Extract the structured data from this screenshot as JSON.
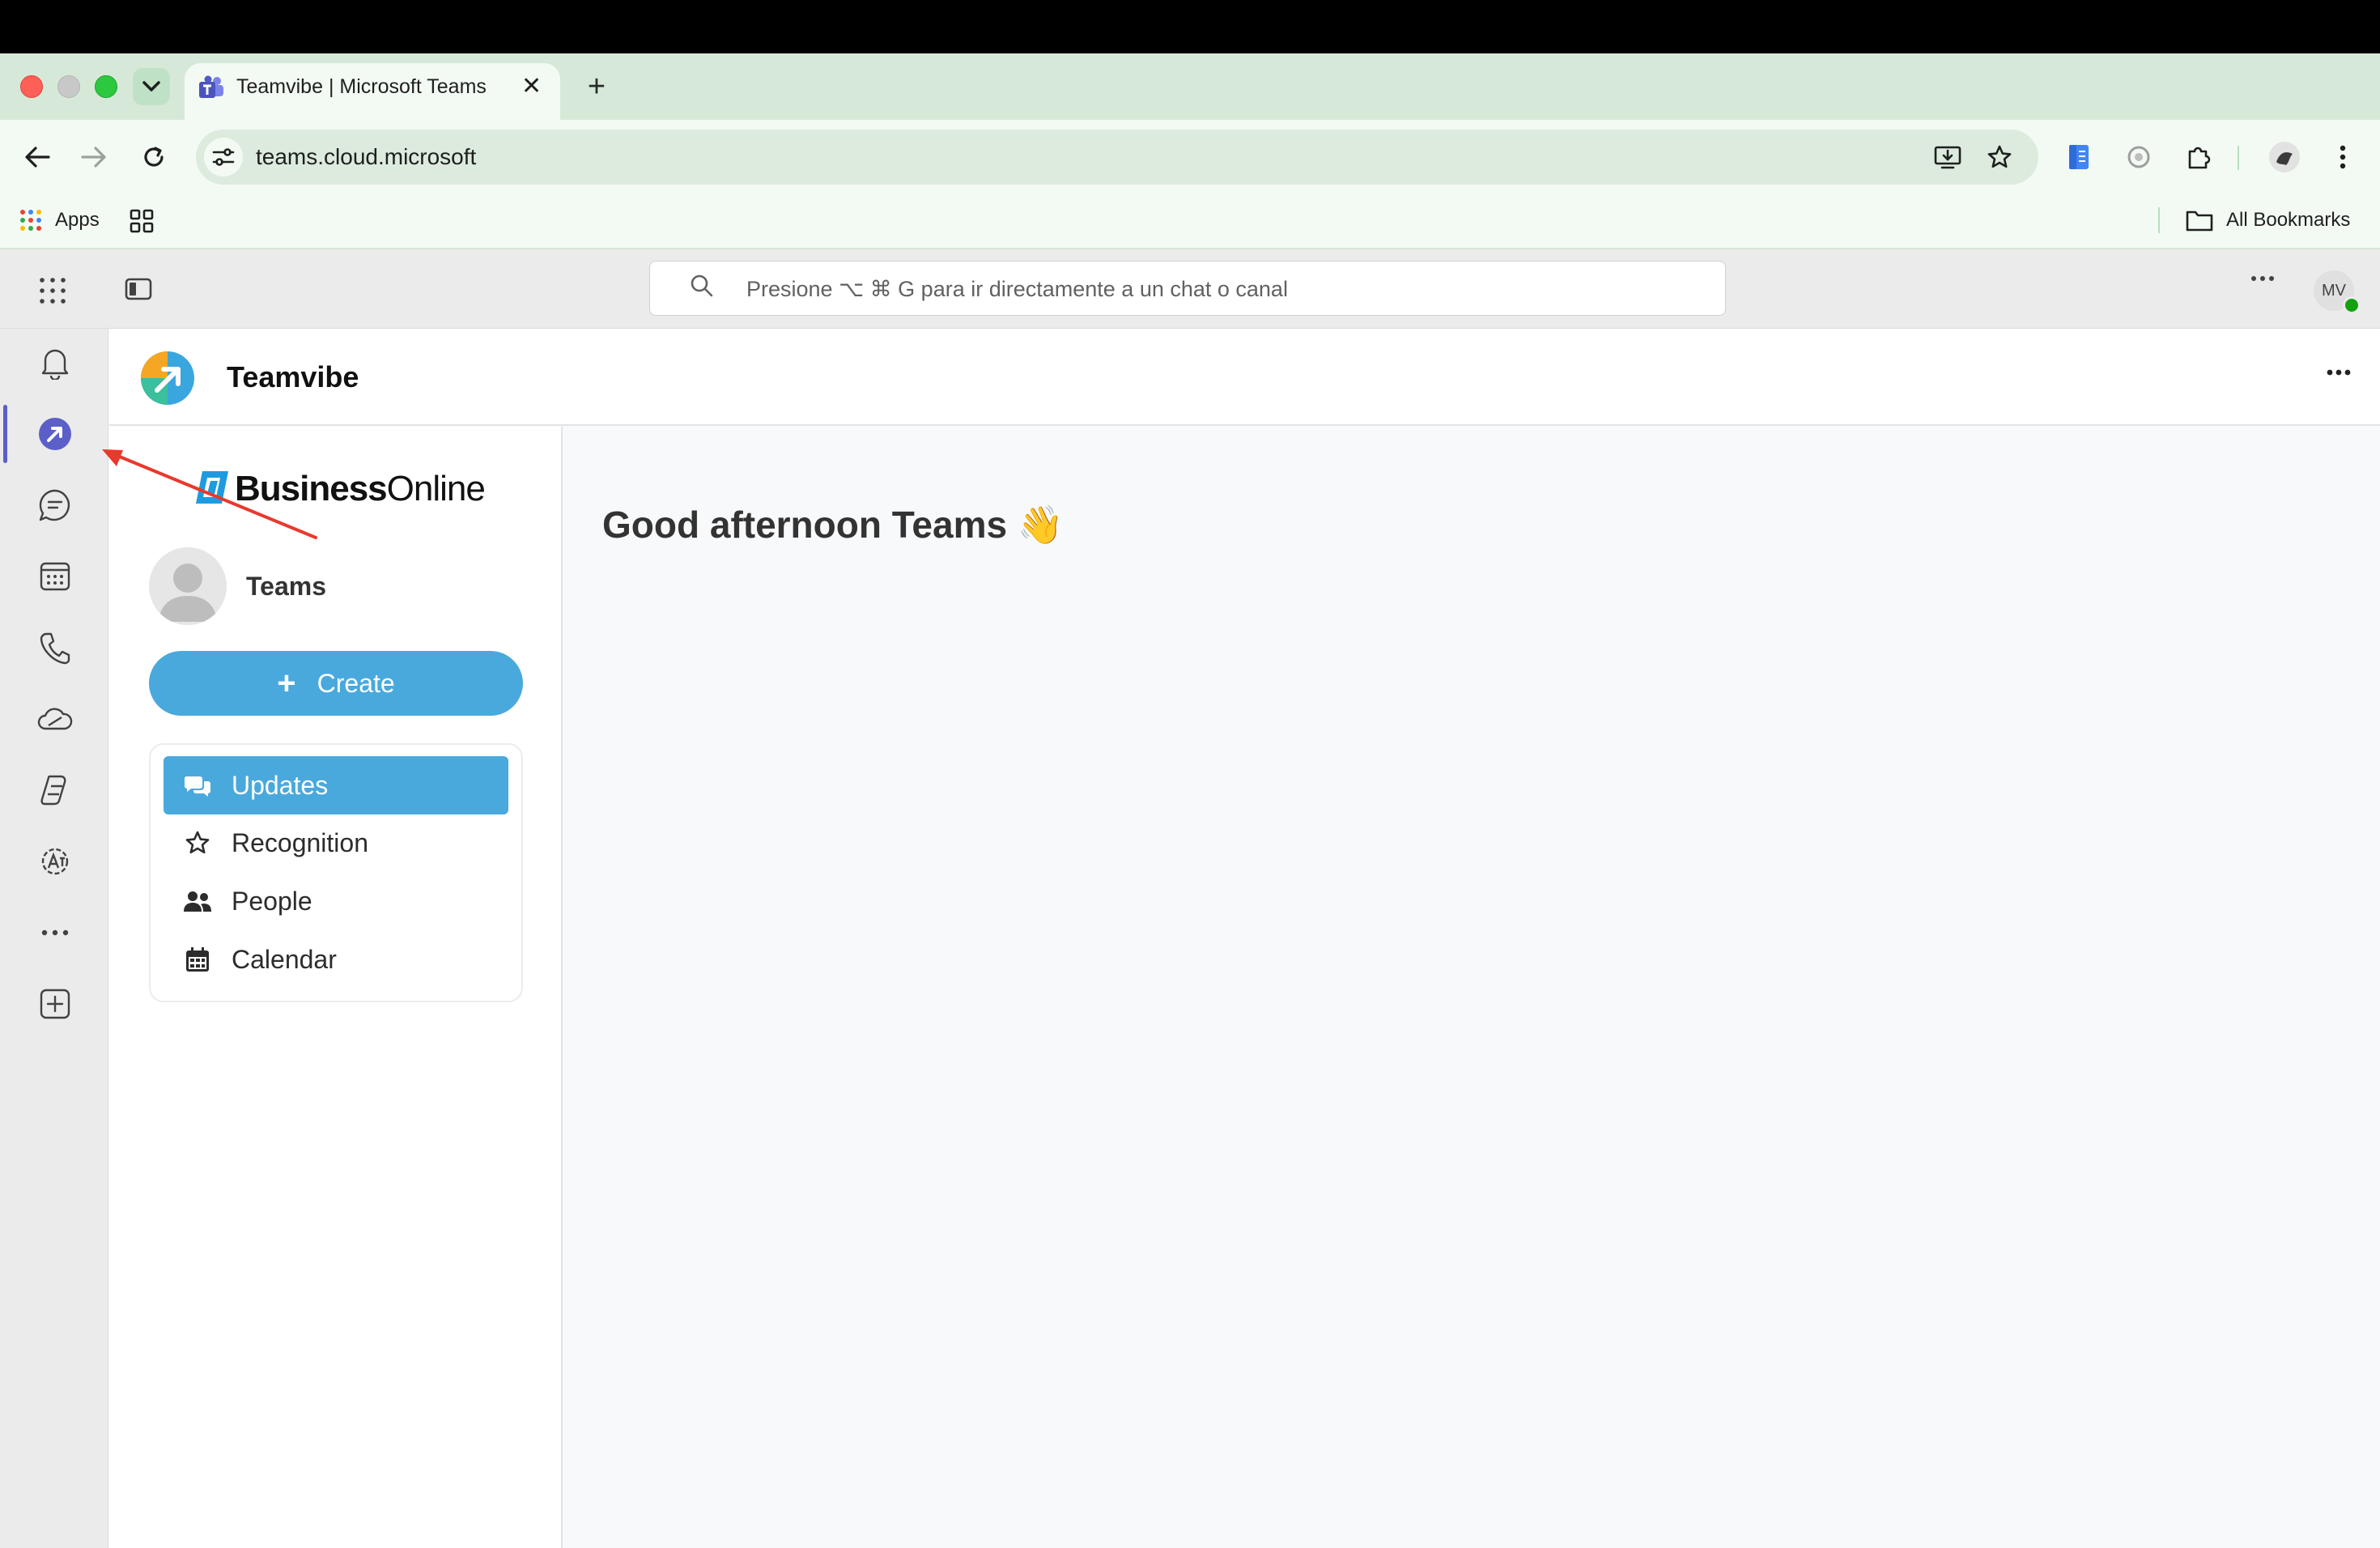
{
  "browser": {
    "tab": {
      "title": "Teamvibe | Microsoft Teams",
      "close": "✕"
    },
    "new_tab": "+",
    "url": "teams.cloud.microsoft",
    "bookmarks": {
      "apps_label": "Apps",
      "all_bookmarks_label": "All Bookmarks"
    }
  },
  "teams": {
    "search": {
      "placeholder": "Presione ⌥ ⌘ G para ir directamente a un chat o canal"
    },
    "user_initials": "MV",
    "app_title": "Teamvibe",
    "rail": [
      "bell-icon",
      "teamvibe-app-icon",
      "chat-icon",
      "calendar-icon",
      "phone-icon",
      "onedrive-icon",
      "copilot-icon",
      "apps-gear-icon",
      "more-icon",
      "add-app-icon"
    ]
  },
  "sidebar": {
    "brand": {
      "bold": "Business",
      "light": "Online"
    },
    "profile_name": "Teams",
    "create_label": "Create",
    "create_plus": "+",
    "nav": [
      {
        "label": "Updates",
        "icon": "comments-icon",
        "active": true
      },
      {
        "label": "Recognition",
        "icon": "star-icon"
      },
      {
        "label": "People",
        "icon": "people-icon"
      },
      {
        "label": "Calendar",
        "icon": "calendar-icon"
      }
    ]
  },
  "main": {
    "greeting": "Good afternoon Teams 👋"
  },
  "colors": {
    "accent": "#4aa9dc",
    "teams_purple": "#5b5fc7",
    "annotation": "#e8392c"
  }
}
